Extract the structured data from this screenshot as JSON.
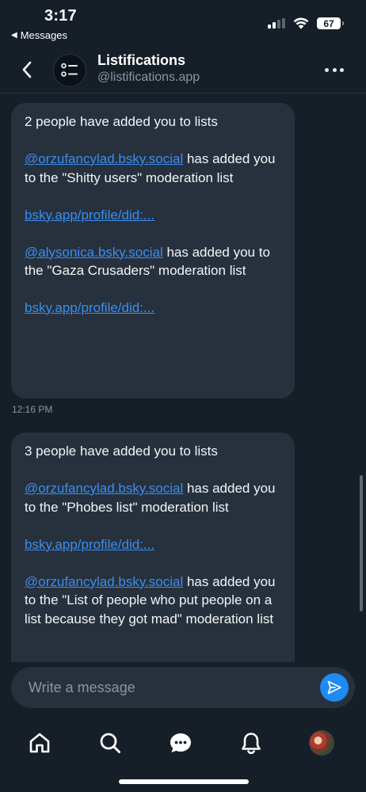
{
  "status_bar": {
    "time": "3:17",
    "back_app": "Messages",
    "battery": "67"
  },
  "header": {
    "title": "Listifications",
    "handle": "@listifications.app"
  },
  "messages": [
    {
      "heading": "2 people have added you to lists",
      "items": [
        {
          "user": "@orzufancylad.bsky.social",
          "text": " has added you to the \"Shitty users\" moderation list",
          "link": "bsky.app/profile/did:..."
        },
        {
          "user": "@alysonica.bsky.social",
          "text": " has added you to the \"Gaza Crusaders\" moderation list",
          "link": "bsky.app/profile/did:..."
        }
      ],
      "time": "12:16 PM"
    },
    {
      "heading": "3 people have added you to lists",
      "items": [
        {
          "user": "@orzufancylad.bsky.social",
          "text": " has added you to the \"Phobes list\" moderation list",
          "link": "bsky.app/profile/did:..."
        },
        {
          "user": "@orzufancylad.bsky.social",
          "text": " has added you to the \"List of people who put people on a list because they got mad\" moderation list"
        }
      ]
    }
  ],
  "composer": {
    "placeholder": "Write a message",
    "value": ""
  },
  "tabbar": {
    "icons": [
      "home-icon",
      "search-icon",
      "chat-icon",
      "bell-icon",
      "profile-avatar"
    ]
  },
  "colors": {
    "background": "#161e27",
    "bubble": "#27313d",
    "link": "#3a8ef0",
    "accent": "#1d8bf1",
    "muted": "#8a96a3"
  }
}
